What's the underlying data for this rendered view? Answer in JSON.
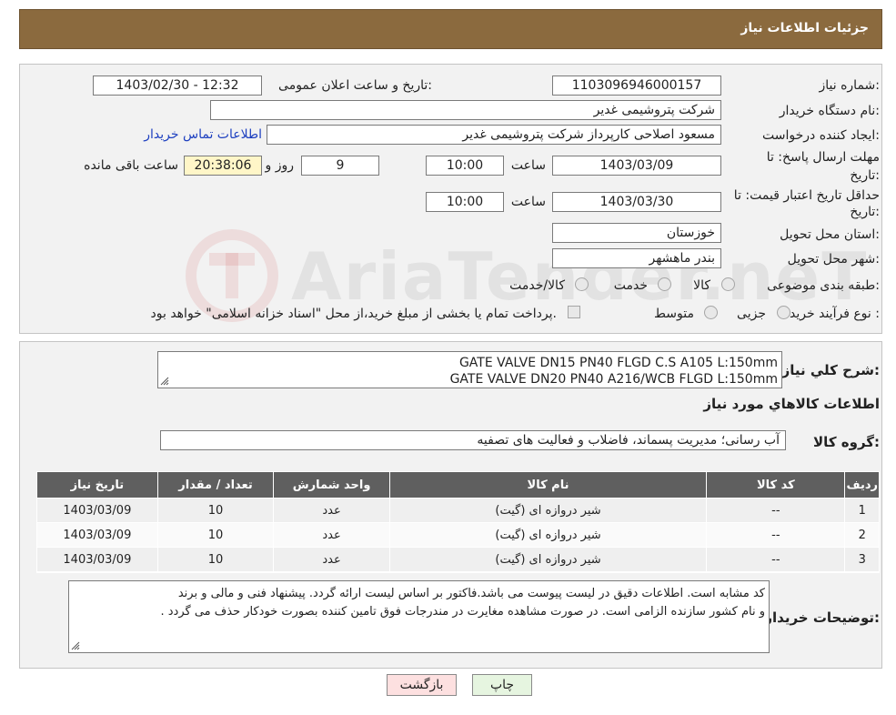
{
  "header": {
    "title": "جزئیات اطلاعات نیاز"
  },
  "form": {
    "need_number_label": "شماره نیاز:",
    "need_number": "1103096946000157",
    "announce_label": "تاریخ و ساعت اعلان عمومی:",
    "announce_value": "1403/02/30 - 12:32",
    "buyer_org_label": "نام دستگاه خریدار:",
    "buyer_org": "شرکت پتروشیمی غدیر",
    "creator_label": "ایجاد کننده درخواست:",
    "creator": "مسعود اصلاحی کارپرداز شرکت پتروشیمی غدیر",
    "contact_link": "اطلاعات تماس خریدار",
    "deadline_label_1": "مهلت ارسال پاسخ: تا",
    "deadline_label_2": "تاریخ:",
    "deadline_date": "1403/03/09",
    "time_label": "ساعت",
    "deadline_time": "10:00",
    "days_value": "9",
    "days_label": "روز و",
    "remaining_time": "20:38:06",
    "remaining_label": "ساعت باقی مانده",
    "validity_label_1": "حداقل تاریخ اعتبار قیمت: تا",
    "validity_label_2": "تاریخ:",
    "validity_date": "1403/03/30",
    "validity_time": "10:00",
    "province_label": "استان محل تحویل:",
    "province": "خوزستان",
    "city_label": "شهر محل تحویل:",
    "city": "بندر ماهشهر",
    "category_label": "طبقه بندی موضوعی:",
    "category_options": [
      "کالا",
      "خدمت",
      "کالا/خدمت"
    ],
    "process_label": "نوع فرآیند خرید :",
    "process_options": [
      "جزیی",
      "متوسط"
    ],
    "payment_note": "پرداخت تمام یا بخشی از مبلغ خرید،از محل \"اسناد خزانه اسلامی\" خواهد بود."
  },
  "details": {
    "description_label": "شرح کلي نياز:",
    "description_lines": [
      "GATE VALVE DN15 PN40 FLGD C.S A105 L:150mm",
      "GATE VALVE DN20 PN40 A216/WCB FLGD  L:150mm"
    ],
    "goods_info_title": "اطلاعات کالاهاي مورد نياز",
    "group_label": "گروه کالا:",
    "group_value": "آب رسانی؛ مدیریت پسماند، فاضلاب و فعالیت های تصفیه",
    "table_headers": [
      "ردیف",
      "کد کالا",
      "نام کالا",
      "واحد شمارش",
      "تعداد / مقدار",
      "تاریخ نیاز"
    ],
    "rows": [
      [
        "1",
        "--",
        "شیر دروازه ای (گیت)",
        "عدد",
        "10",
        "1403/03/09"
      ],
      [
        "2",
        "--",
        "شیر دروازه ای (گیت)",
        "عدد",
        "10",
        "1403/03/09"
      ],
      [
        "3",
        "--",
        "شیر دروازه ای (گیت)",
        "عدد",
        "10",
        "1403/03/09"
      ]
    ],
    "buyer_notes_label": "توضیحات خریدار:",
    "buyer_notes_lines": [
      "کد مشابه است. اطلاعات دقیق در لیست پیوست می باشد.فاکتور بر اساس لیست ارائه گردد. پیشنهاد فنی و مالی و  برند",
      "و نام کشور سازنده الزامی است. در صورت مشاهده مغایرت در مندرجات فوق تامین کننده بصورت خودکار حذف می گردد ."
    ]
  },
  "buttons": {
    "print": "چاپ",
    "back": "بازگشت"
  },
  "watermark": {
    "text": "AriaTender.neT"
  },
  "colors": {
    "header_bg": "#8b6a3e",
    "table_header_bg": "#5f5f5f",
    "link": "#1e40c0",
    "remaining_bg": "#fff6c8",
    "back_button_bg": "#fde0e0",
    "print_button_bg": "#e6f5e0"
  }
}
